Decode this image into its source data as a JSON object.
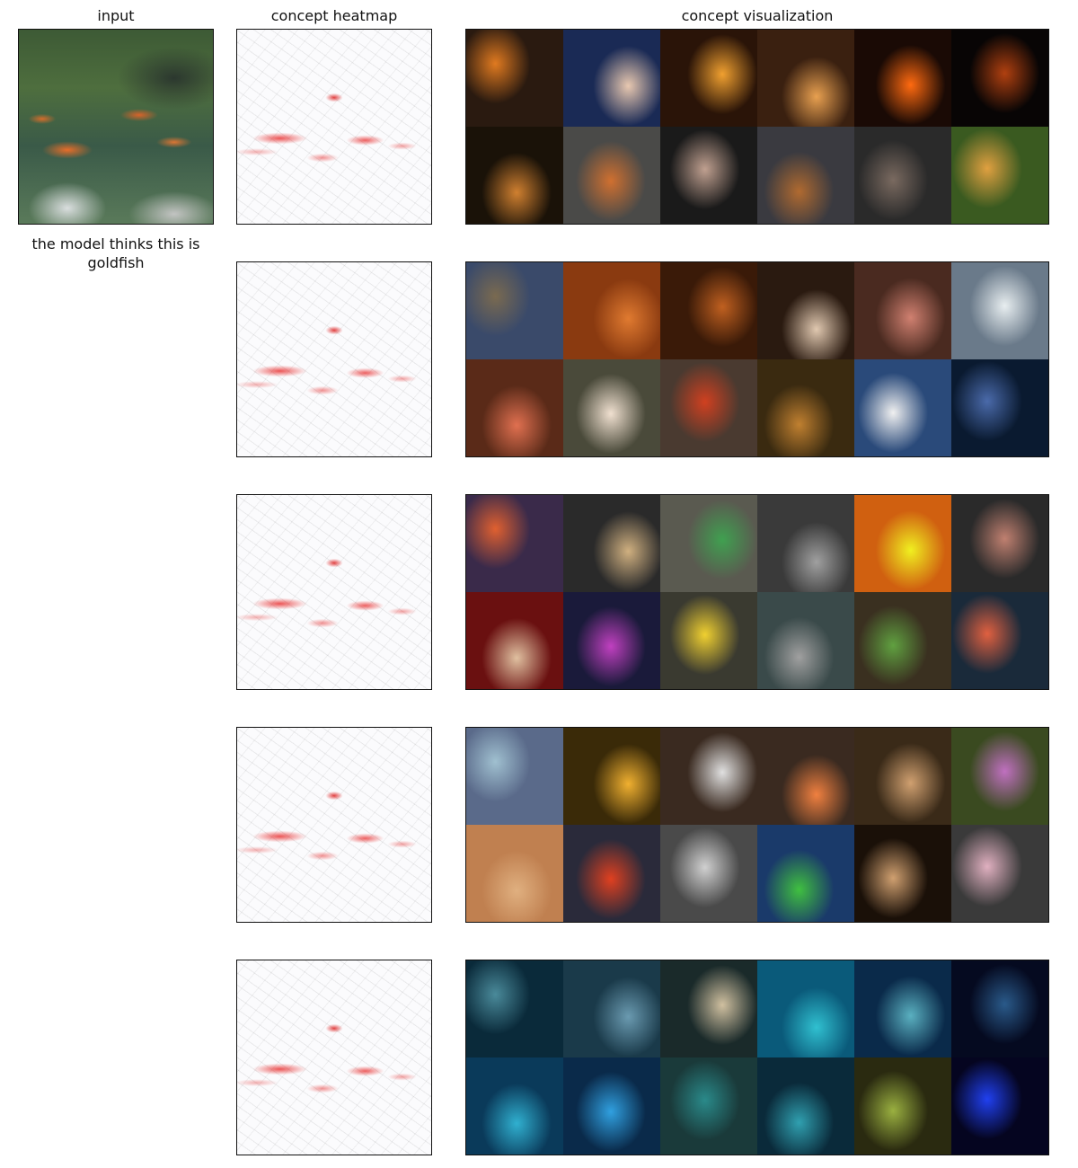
{
  "headers": {
    "input": "input",
    "heatmap": "concept heatmap",
    "visualization": "concept visualization"
  },
  "prediction": {
    "caption": "the model thinks this is goldfish"
  },
  "concepts": [
    {
      "id": 1,
      "tiles": [
        [
          "#2a1a10",
          "#e07a20"
        ],
        [
          "#1a2a55",
          "#e8c8b0"
        ],
        [
          "#2a1408",
          "#f0a030"
        ],
        [
          "#3a2010",
          "#e8a050"
        ],
        [
          "#1a0a05",
          "#ff6a10"
        ],
        [
          "#080505",
          "#b04010"
        ],
        [
          "#1a1208",
          "#d08030"
        ],
        [
          "#4a4a48",
          "#d07030"
        ],
        [
          "#1a1a1a",
          "#c0a090"
        ],
        [
          "#3a3a40",
          "#b06a30"
        ],
        [
          "#2a2a2a",
          "#7a6a60"
        ],
        [
          "#3a5a20",
          "#e0a040"
        ]
      ]
    },
    {
      "id": 2,
      "tiles": [
        [
          "#3a4a6a",
          "#7a6a50"
        ],
        [
          "#8a3a10",
          "#e07a30"
        ],
        [
          "#3a1a08",
          "#c06020"
        ],
        [
          "#2a1a10",
          "#e0c8b0"
        ],
        [
          "#4a2a20",
          "#d08070"
        ],
        [
          "#6a7a8a",
          "#e8eef0"
        ],
        [
          "#5a2a18",
          "#e07050"
        ],
        [
          "#4a4a3a",
          "#f0e0d0"
        ],
        [
          "#4a3a30",
          "#d04020"
        ],
        [
          "#3a2a10",
          "#c08030"
        ],
        [
          "#2a4a7a",
          "#f0f0f0"
        ],
        [
          "#0a1a30",
          "#4a6aaa"
        ]
      ]
    },
    {
      "id": 3,
      "tiles": [
        [
          "#3a2a4a",
          "#e06030"
        ],
        [
          "#2a2a2a",
          "#d0b080"
        ],
        [
          "#5a5a50",
          "#40a050"
        ],
        [
          "#3a3a3a",
          "#a0a0a0"
        ],
        [
          "#d06010",
          "#f0f020"
        ],
        [
          "#2a2a2a",
          "#c08070"
        ],
        [
          "#6a1010",
          "#e0c0a0"
        ],
        [
          "#1a1a3a",
          "#c040c0"
        ],
        [
          "#3a3a30",
          "#f0d030"
        ],
        [
          "#3a4a4a",
          "#a0a0a0"
        ],
        [
          "#3a3020",
          "#60a040"
        ],
        [
          "#1a2a3a",
          "#e06040"
        ]
      ]
    },
    {
      "id": 4,
      "tiles": [
        [
          "#5a6a8a",
          "#a0c0d0"
        ],
        [
          "#3a2a08",
          "#f0b030"
        ],
        [
          "#3a2a20",
          "#e0e0e0"
        ],
        [
          "#3a2a20",
          "#f08040"
        ],
        [
          "#3a2a18",
          "#d0a070"
        ],
        [
          "#3a4a20",
          "#c070c0"
        ],
        [
          "#c08050",
          "#e0b080"
        ],
        [
          "#2a2a3a",
          "#e04020"
        ],
        [
          "#4a4a4a",
          "#d0d0d0"
        ],
        [
          "#1a3a6a",
          "#40c040"
        ],
        [
          "#1a1008",
          "#d0a070"
        ],
        [
          "#3a3a3a",
          "#e0b0c0"
        ]
      ]
    },
    {
      "id": 5,
      "tiles": [
        [
          "#0a2a3a",
          "#4a8a9a"
        ],
        [
          "#1a3a4a",
          "#6a9ab0"
        ],
        [
          "#1a2a2a",
          "#d0c0a0"
        ],
        [
          "#0a5a7a",
          "#30c0d0"
        ],
        [
          "#0a2a4a",
          "#5ab0c0"
        ],
        [
          "#050a20",
          "#2a5a8a"
        ],
        [
          "#0a3a5a",
          "#30b0d0"
        ],
        [
          "#0a2a4a",
          "#30a0e0"
        ],
        [
          "#1a3a3a",
          "#2a8a8a"
        ],
        [
          "#0a2a3a",
          "#30a0b0"
        ],
        [
          "#2a2a10",
          "#9ab040"
        ],
        [
          "#050520",
          "#2040f0"
        ]
      ]
    }
  ]
}
